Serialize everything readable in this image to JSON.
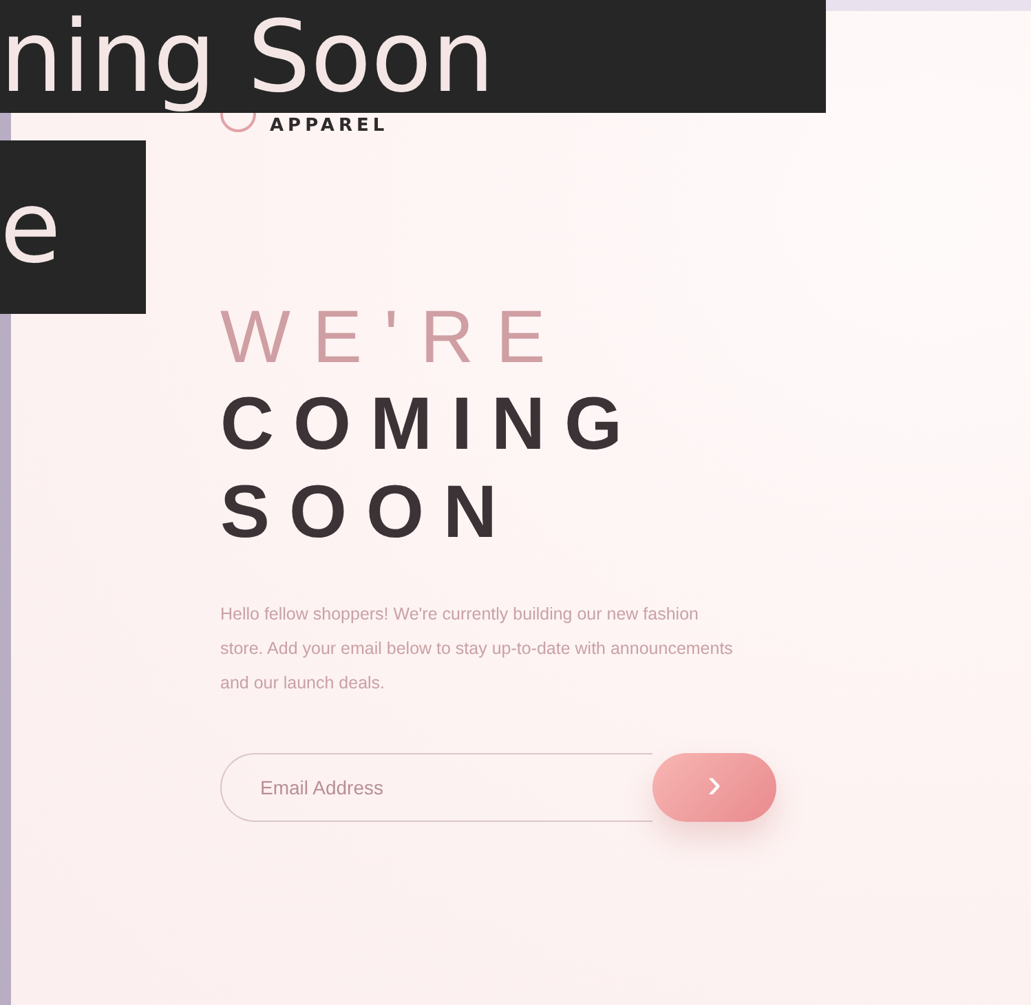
{
  "caption_overlay": {
    "lines": [
      "ning Soon",
      "e"
    ]
  },
  "logo": {
    "wordmark": "APPAREL"
  },
  "hero": {
    "heading_light": "WE'RE",
    "heading_bold": [
      "COMING",
      "SOON"
    ],
    "description": "Hello fellow shoppers! We're currently building our new fashion store. Add your email below to stay up-to-date with announcements and our launch deals."
  },
  "signup": {
    "email": {
      "placeholder": "Email Address"
    },
    "submit": {
      "label": "›"
    }
  }
}
